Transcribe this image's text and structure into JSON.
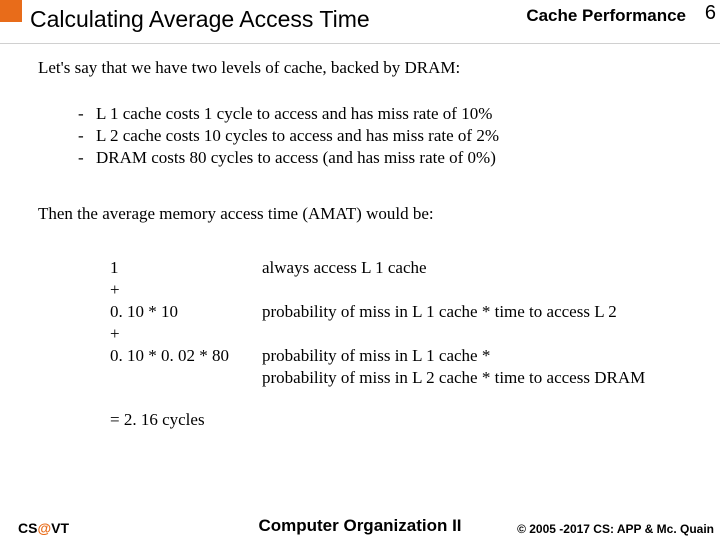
{
  "header": {
    "title": "Calculating Average Access Time",
    "section": "Cache Performance",
    "page": "6"
  },
  "intro": "Let's say that we have two levels of cache, backed by DRAM:",
  "bullets": [
    "L 1 cache costs 1 cycle to access and has miss rate of 10%",
    "L 2 cache costs 10 cycles to access and has miss rate of 2%",
    "DRAM costs 80 cycles to access (and has miss rate of 0%)"
  ],
  "amat_line": "Then the average memory access time (AMAT) would be:",
  "calc": [
    {
      "left": "1",
      "right": "always access L 1 cache"
    },
    {
      "left": "+",
      "right": ""
    },
    {
      "left": "0. 10 * 10",
      "right": "probability of miss in L 1 cache * time to access L 2"
    },
    {
      "left": "+",
      "right": ""
    },
    {
      "left": "0. 10 * 0. 02 * 80",
      "right": "probability of miss in L 1 cache *"
    },
    {
      "left": "",
      "right": "probability of miss in L 2 cache * time to access DRAM"
    }
  ],
  "result": "= 2. 16 cycles",
  "footer": {
    "left_cs": "CS",
    "left_at": "@",
    "left_vt": "VT",
    "center": "Computer Organization II",
    "right": "© 2005 -2017 CS: APP & Mc. Quain"
  }
}
